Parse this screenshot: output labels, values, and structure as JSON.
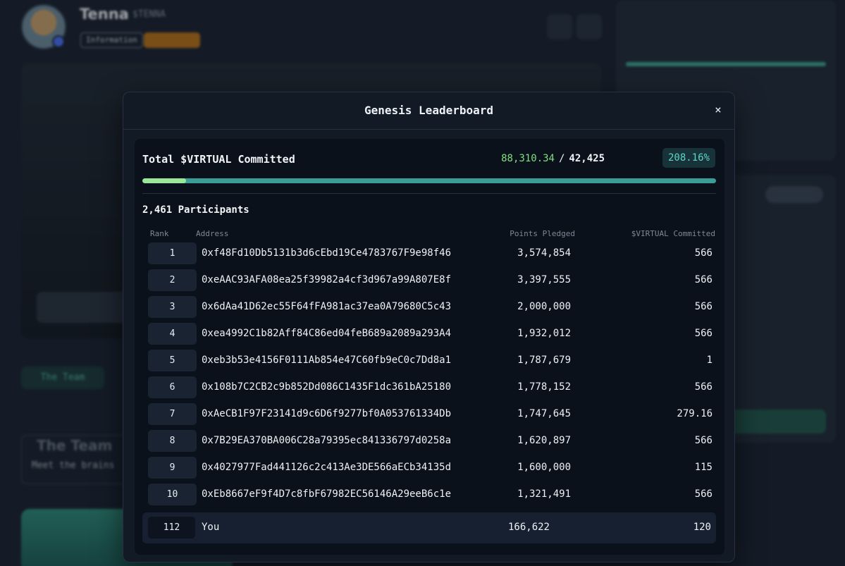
{
  "background": {
    "app_name": "Tenna",
    "ticker": "$TENNA",
    "info_chip": "Information",
    "team_tab": "The Team",
    "team_title": "The Team",
    "team_subtitle": "Meet the brains"
  },
  "modal": {
    "title": "Genesis Leaderboard",
    "close_label": "×",
    "total_label": "Total $VIRTUAL Committed",
    "total_committed": "88,310.34",
    "separator": "/",
    "total_target": "42,425",
    "percent": "208.16%",
    "progress_fraction": 0.0765,
    "participants": "2,461 Participants",
    "columns": {
      "rank": "Rank",
      "address": "Address",
      "points": "Points Pledged",
      "virtual": "$VIRTUAL Committed"
    },
    "rows": [
      {
        "rank": "1",
        "address": "0xf48Fd10Db5131b3d6cEbd19Ce4783767F9e98f46",
        "points": "3,574,854",
        "virtual": "566"
      },
      {
        "rank": "2",
        "address": "0xeAAC93AFA08ea25f39982a4cf3d967a99A807E8f",
        "points": "3,397,555",
        "virtual": "566"
      },
      {
        "rank": "3",
        "address": "0x6dAa41D62ec55F64fFA981ac37ea0A79680C5c43",
        "points": "2,000,000",
        "virtual": "566"
      },
      {
        "rank": "4",
        "address": "0xea4992C1b82Aff84C86ed04feB689a2089a293A4",
        "points": "1,932,012",
        "virtual": "566"
      },
      {
        "rank": "5",
        "address": "0xeb3b53e4156F0111Ab854e47C60fb9eC0c7Dd8a1",
        "points": "1,787,679",
        "virtual": "1"
      },
      {
        "rank": "6",
        "address": "0x108b7C2CB2c9b852Dd086C1435F1dc361bA25180",
        "points": "1,778,152",
        "virtual": "566"
      },
      {
        "rank": "7",
        "address": "0xAeCB1F97F23141d9c6D6f9277bf0A053761334Db",
        "points": "1,747,645",
        "virtual": "279.16"
      },
      {
        "rank": "8",
        "address": "0x7B29EA370BA006C28a79395ec841336797d0258a",
        "points": "1,620,897",
        "virtual": "566"
      },
      {
        "rank": "9",
        "address": "0x4027977Fad441126c2c413Ae3DE566aECb34135d",
        "points": "1,600,000",
        "virtual": "115"
      },
      {
        "rank": "10",
        "address": "0xEb8667eF9f4D7c8fbF67982EC56146A29eeB6c1e",
        "points": "1,321,491",
        "virtual": "566"
      }
    ],
    "you": {
      "rank": "112",
      "label": "You",
      "points": "166,622",
      "virtual": "120"
    }
  }
}
